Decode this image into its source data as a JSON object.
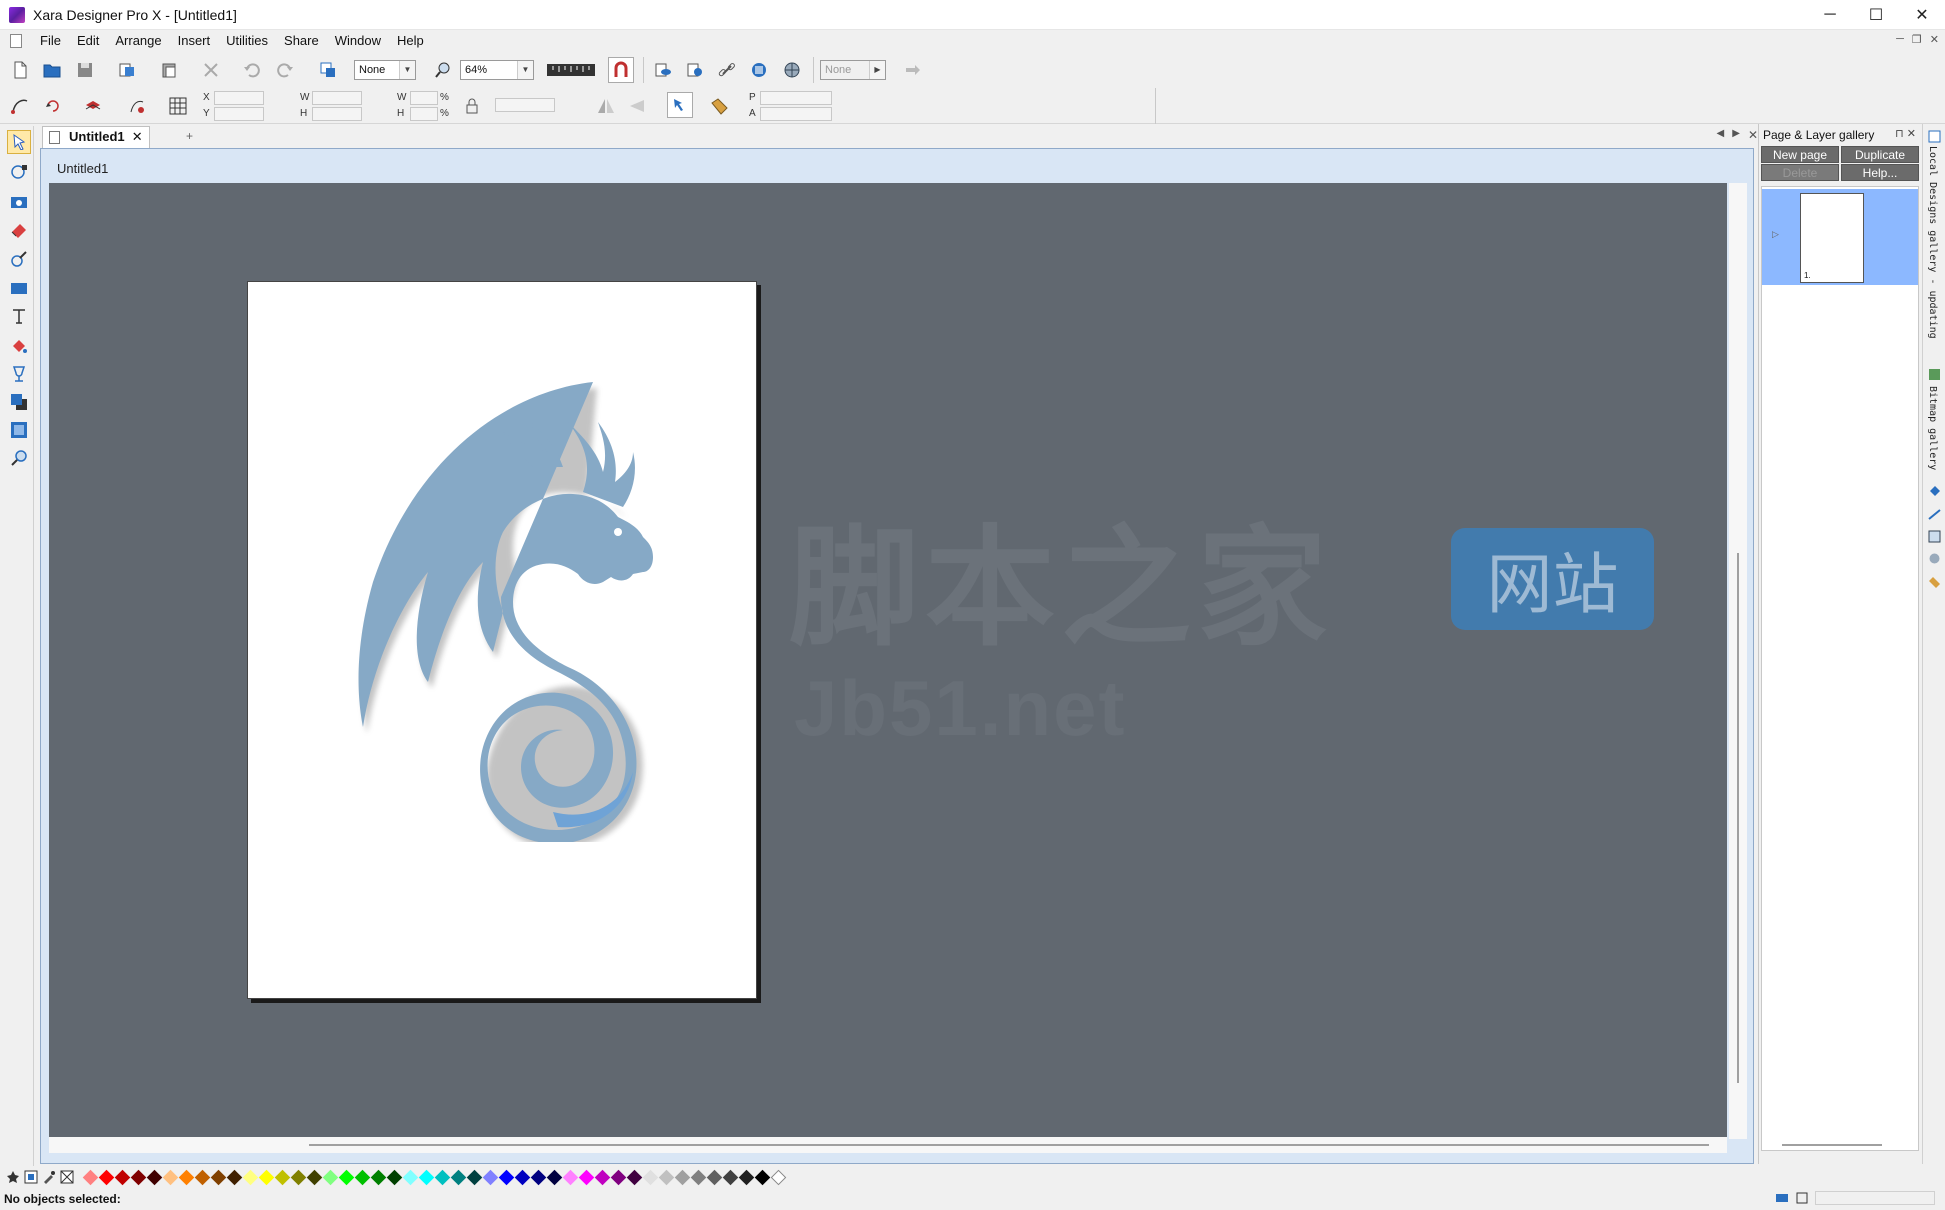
{
  "window": {
    "title": "Xara Designer Pro X - [Untitled1]",
    "minimize": "─",
    "maximize": "☐",
    "close": "✕"
  },
  "menu": [
    "File",
    "Edit",
    "Arrange",
    "Insert",
    "Utilities",
    "Share",
    "Window",
    "Help"
  ],
  "mdi": {
    "minimize": "─",
    "restore": "❐",
    "close": "✕"
  },
  "toolbar": {
    "quality_value": "None",
    "zoom_value": "64%",
    "feather_value": "None"
  },
  "infobar": {
    "x_label": "X",
    "y_label": "Y",
    "w_label": "W",
    "h_label": "H",
    "w_pct_label": "W",
    "h_pct_label": "H",
    "pct": "%",
    "p_label": "P",
    "a_label": "A"
  },
  "tabs": {
    "doc_tab": "Untitled1",
    "close": "✕",
    "new": "+",
    "nav_prev": "◀",
    "nav_next": "▶",
    "nav_close": "✕"
  },
  "document": {
    "title": "Untitled1"
  },
  "watermark": {
    "text": "脚本之家",
    "badge": "网站",
    "url": "Jb51.net"
  },
  "gallery": {
    "title": "Page & Layer gallery",
    "pin": "⊓",
    "close": "✕",
    "buttons": {
      "new_page": "New page",
      "duplicate": "Duplicate",
      "delete": "Delete",
      "help": "Help..."
    },
    "pages": [
      {
        "number": "1."
      }
    ],
    "expand": "▷"
  },
  "side_tabs": {
    "local_designs": "Local Designs gallery  - updating",
    "bitmap": "Bitmap gallery"
  },
  "status": {
    "text": "No objects selected:"
  },
  "palette": {
    "colors": [
      "#ff8080",
      "#ff0000",
      "#c00000",
      "#800000",
      "#400000",
      "#ffc080",
      "#ff8000",
      "#c06000",
      "#804000",
      "#402000",
      "#ffff80",
      "#ffff00",
      "#c0c000",
      "#808000",
      "#404000",
      "#80ff80",
      "#00ff00",
      "#00c000",
      "#008000",
      "#004000",
      "#80ffff",
      "#00ffff",
      "#00c0c0",
      "#008080",
      "#004040",
      "#8080ff",
      "#0000ff",
      "#0000c0",
      "#000080",
      "#000040",
      "#ff80ff",
      "#ff00ff",
      "#c000c0",
      "#800080",
      "#400040",
      "#e0e0e0",
      "#c0c0c0",
      "#a0a0a0",
      "#808080",
      "#606060",
      "#404040",
      "#202020",
      "#000000",
      "#ffffff"
    ]
  }
}
